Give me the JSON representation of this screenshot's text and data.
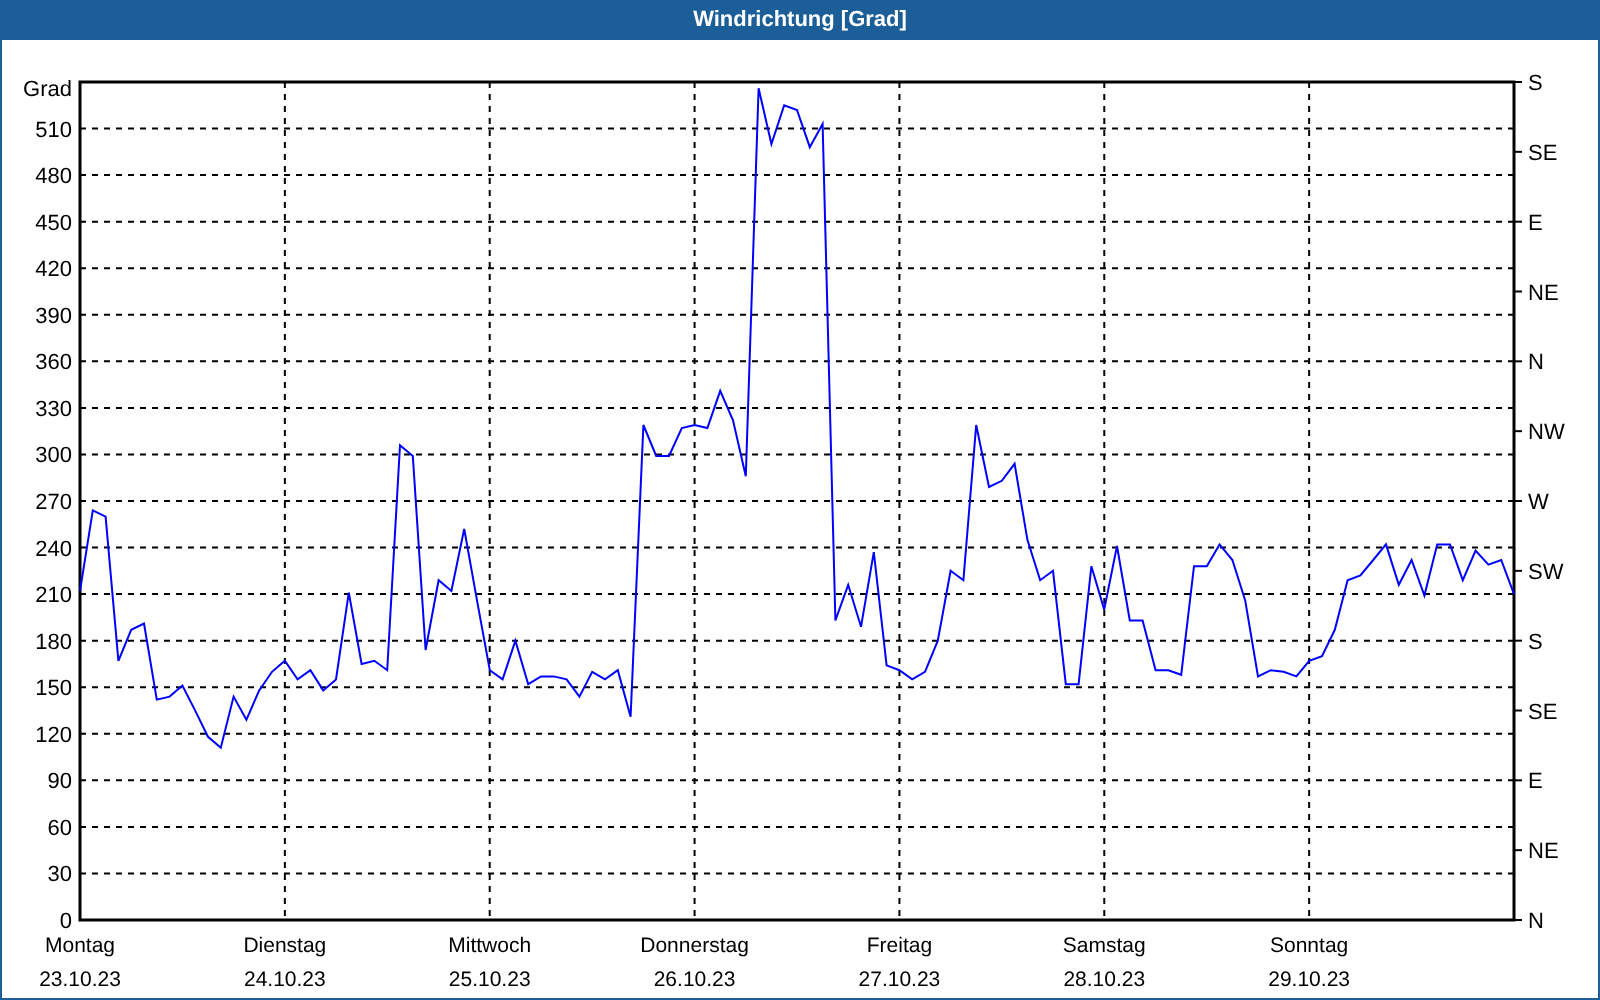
{
  "window": {
    "title": "Windrichtung [Grad]"
  },
  "chart": {
    "compass_ticks": [
      "S",
      "SE",
      "E",
      "NE",
      "N",
      "NW",
      "W",
      "SW",
      "S",
      "SE",
      "E",
      "NE",
      "N"
    ],
    "dates": [
      "23.10.23",
      "24.10.23",
      "25.10.23",
      "26.10.23",
      "27.10.23",
      "28.10.23",
      "29.10.23"
    ],
    "chart_data": {
      "type": "line",
      "grid": true,
      "ylabel": "Grad",
      "ylim": [
        0,
        540
      ],
      "yticks": [
        0,
        30,
        60,
        90,
        120,
        150,
        180,
        210,
        240,
        270,
        300,
        330,
        360,
        390,
        420,
        450,
        480,
        510
      ],
      "categories": [
        "Montag",
        null,
        null,
        null,
        null,
        null,
        null,
        null,
        null,
        null,
        null,
        null,
        null,
        null,
        null,
        null,
        "Dienstag",
        null,
        null,
        null,
        null,
        null,
        null,
        null,
        null,
        null,
        null,
        null,
        null,
        null,
        null,
        null,
        "Mittwoch",
        null,
        null,
        null,
        null,
        null,
        null,
        null,
        null,
        null,
        null,
        null,
        null,
        null,
        null,
        null,
        "Donnerstag",
        null,
        null,
        null,
        null,
        null,
        null,
        null,
        null,
        null,
        null,
        null,
        null,
        null,
        null,
        null,
        "Freitag",
        null,
        null,
        null,
        null,
        null,
        null,
        null,
        null,
        null,
        null,
        null,
        null,
        null,
        null,
        null,
        "Samstag",
        null,
        null,
        null,
        null,
        null,
        null,
        null,
        null,
        null,
        null,
        null,
        null,
        null,
        null,
        null,
        "Sonntag",
        null,
        null,
        null,
        null,
        null,
        null,
        null,
        null,
        null,
        null,
        null,
        null,
        null,
        null,
        null,
        null
      ],
      "series": [
        {
          "color": "#0000ff",
          "values": [
            212,
            264,
            260,
            167,
            187,
            191,
            142,
            144,
            151,
            135,
            118,
            111,
            144,
            129,
            148,
            160,
            167,
            155,
            161,
            148,
            155,
            211,
            165,
            167,
            161,
            306,
            299,
            174,
            219,
            212,
            252,
            206,
            161,
            155,
            180,
            152,
            157,
            157,
            155,
            144,
            160,
            155,
            161,
            131,
            319,
            299,
            299,
            317,
            319,
            317,
            341,
            322,
            286,
            536,
            500,
            525,
            522,
            498,
            513,
            193,
            216,
            189,
            237,
            164,
            161,
            155,
            160,
            180,
            225,
            219,
            319,
            279,
            283,
            294,
            245,
            219,
            225,
            152,
            152,
            228,
            200,
            241,
            193,
            193,
            161,
            161,
            158,
            228,
            228,
            242,
            232,
            206,
            157,
            161,
            160,
            157,
            167,
            170,
            187,
            219,
            222,
            232,
            242,
            216,
            232,
            209,
            242,
            242,
            219,
            238,
            229,
            232,
            210
          ]
        }
      ]
    }
  }
}
